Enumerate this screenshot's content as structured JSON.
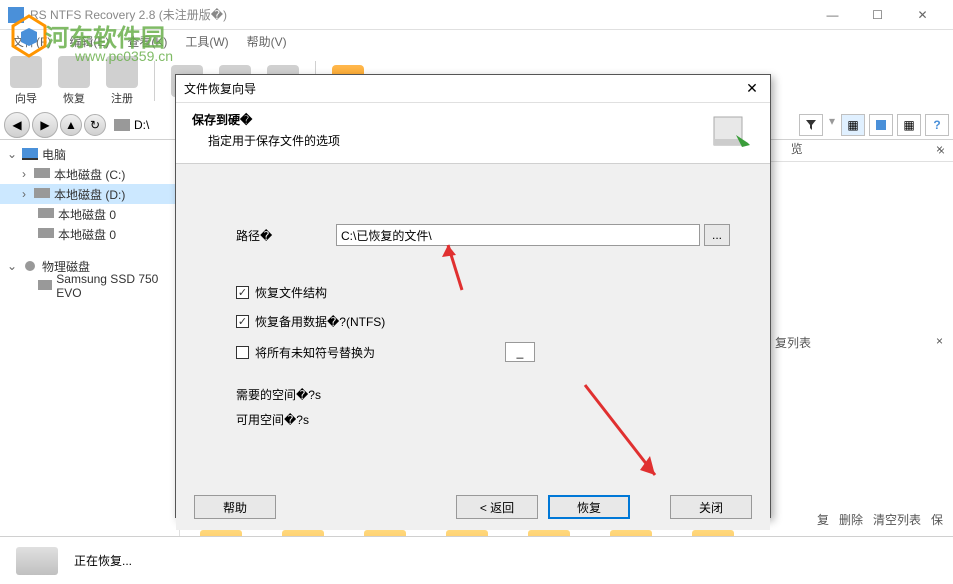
{
  "window": {
    "title": "RS NTFS Recovery 2.8 (未注册版�)"
  },
  "watermark": {
    "text": "河东软件园",
    "url": "www.pc0359.cn"
  },
  "menu": {
    "file": "文件(F)",
    "edit": "编辑(E)",
    "view": "查看(K)",
    "tools": "工具(W)",
    "help": "帮助(V)"
  },
  "toolbar": {
    "wizard": "向导",
    "recover": "恢复",
    "register": "注册"
  },
  "nav": {
    "path": "D:\\"
  },
  "tree": {
    "computer": "电脑",
    "disk_c": "本地磁盘 (C:)",
    "disk_d": "本地磁盘 (D:)",
    "disk_0a": "本地磁盘 0",
    "disk_0b": "本地磁盘 0",
    "physical": "物理磁盘",
    "ssd": "Samsung SSD 750 EVO"
  },
  "content": {
    "header_left": "览",
    "header_right": "复列表",
    "footer_actions": {
      "recover": "复",
      "delete": "删除",
      "clear": "清空列表",
      "save": "保"
    }
  },
  "dialog": {
    "title": "文件恢复向导",
    "header_title": "保存到硬�",
    "header_sub": "指定用于保存文件的选项",
    "path_label": "路径�",
    "path_value": "C:\\已恢复的文件\\",
    "browse": "...",
    "cb_structure": "恢复文件结构",
    "cb_backup": "恢复备用数据�?(NTFS)",
    "cb_replace": "将所有未知符号替换为",
    "replace_char": "_",
    "space_needed": "需要的空间�?s",
    "space_avail": "可用空间�?s",
    "btn_help": "帮助",
    "btn_back": "< 返回",
    "btn_recover": "恢复",
    "btn_close": "关闭"
  },
  "status": {
    "text": "正在恢复..."
  }
}
